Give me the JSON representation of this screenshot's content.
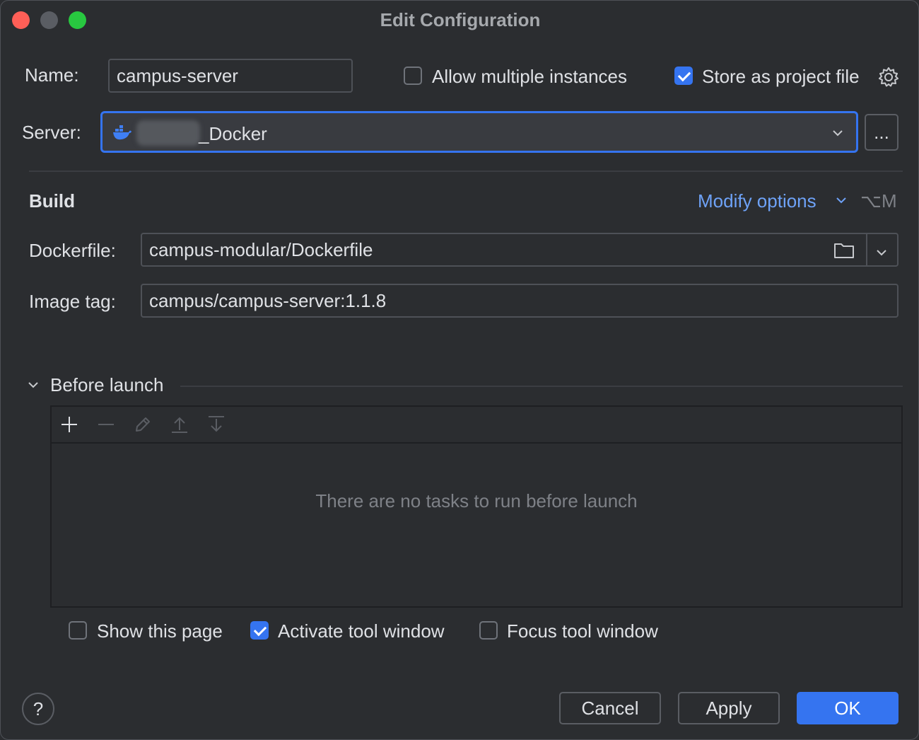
{
  "window": {
    "title": "Edit Configuration"
  },
  "name_field": {
    "label": "Name:",
    "value": "campus-server"
  },
  "options": {
    "allow_multiple": {
      "label": "Allow multiple instances",
      "checked": false
    },
    "store_project": {
      "label": "Store as project file",
      "checked": true
    }
  },
  "server": {
    "label": "Server:",
    "value": "_Docker",
    "more_button": "..."
  },
  "build": {
    "heading": "Build",
    "modify_options": "Modify options",
    "shortcut": "⌥M",
    "dockerfile": {
      "label": "Dockerfile:",
      "value": "campus-modular/Dockerfile"
    },
    "image_tag": {
      "label": "Image tag:",
      "value": "campus/campus-server:1.1.8"
    }
  },
  "before_launch": {
    "heading": "Before launch",
    "empty_text": "There are no tasks to run before launch",
    "toolbar": [
      "add-icon",
      "remove-icon",
      "edit-icon",
      "move-up-icon",
      "move-down-icon"
    ]
  },
  "launch_options": {
    "show_page": {
      "label": "Show this page",
      "checked": false
    },
    "activate_tool": {
      "label": "Activate tool window",
      "checked": true
    },
    "focus_tool": {
      "label": "Focus tool window",
      "checked": false
    }
  },
  "footer": {
    "help": "?",
    "cancel": "Cancel",
    "apply": "Apply",
    "ok": "OK"
  },
  "colors": {
    "background": "#2b2d30",
    "accent": "#3574f0",
    "link": "#6ea2f7",
    "close": "#ff5f57",
    "minimize": "#5a5d63",
    "zoom": "#28c840"
  }
}
